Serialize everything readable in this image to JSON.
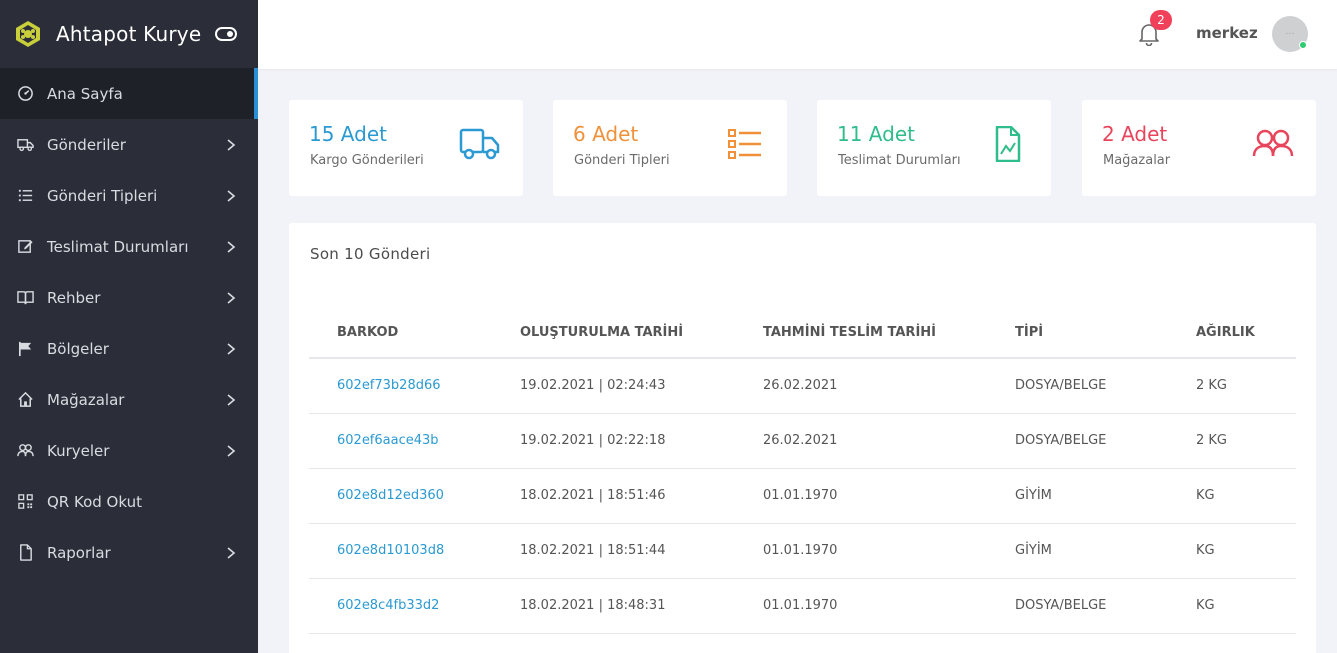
{
  "app": {
    "title": "Ahtapot Kurye"
  },
  "sidebar": {
    "items": [
      {
        "label": "Ana Sayfa",
        "icon": "dashboard-icon",
        "active": true,
        "has_children": false
      },
      {
        "label": "Gönderiler",
        "icon": "truck-icon",
        "active": false,
        "has_children": true
      },
      {
        "label": "Gönderi Tipleri",
        "icon": "list-icon",
        "active": false,
        "has_children": true
      },
      {
        "label": "Teslimat Durumları",
        "icon": "edit-icon",
        "active": false,
        "has_children": true
      },
      {
        "label": "Rehber",
        "icon": "book-icon",
        "active": false,
        "has_children": true
      },
      {
        "label": "Bölgeler",
        "icon": "flag-icon",
        "active": false,
        "has_children": true
      },
      {
        "label": "Mağazalar",
        "icon": "home-icon",
        "active": false,
        "has_children": true
      },
      {
        "label": "Kuryeler",
        "icon": "users-icon",
        "active": false,
        "has_children": true
      },
      {
        "label": "QR Kod Okut",
        "icon": "qr-icon",
        "active": false,
        "has_children": false
      },
      {
        "label": "Raporlar",
        "icon": "file-icon",
        "active": false,
        "has_children": true
      }
    ]
  },
  "topbar": {
    "notification_count": "2",
    "username": "merkez"
  },
  "stats": [
    {
      "value": "15 Adet",
      "label": "Kargo Gönderileri",
      "color": "#2b9ad2",
      "icon": "truck-icon"
    },
    {
      "value": "6 Adet",
      "label": "Gönderi Tipleri",
      "color": "#f0913a",
      "icon": "list-icon"
    },
    {
      "value": "11 Adet",
      "label": "Teslimat Durumları",
      "color": "#2ebd8b",
      "icon": "chart-file-icon"
    },
    {
      "value": "2 Adet",
      "label": "Mağazalar",
      "color": "#e8455c",
      "icon": "users-icon"
    }
  ],
  "recent": {
    "title": "Son 10 Gönderi",
    "columns": [
      "BARKOD",
      "OLUŞTURULMA TARİHİ",
      "TAHMİNİ TESLİM TARİHİ",
      "TİPİ",
      "AĞIRLIK"
    ],
    "rows": [
      [
        "602ef73b28d66",
        "19.02.2021 | 02:24:43",
        "26.02.2021",
        "DOSYA/BELGE",
        "2 KG"
      ],
      [
        "602ef6aace43b",
        "19.02.2021 | 02:22:18",
        "26.02.2021",
        "DOSYA/BELGE",
        "2 KG"
      ],
      [
        "602e8d12ed360",
        "18.02.2021 | 18:51:46",
        "01.01.1970",
        "GİYİM",
        "KG"
      ],
      [
        "602e8d10103d8",
        "18.02.2021 | 18:51:44",
        "01.01.1970",
        "GİYİM",
        "KG"
      ],
      [
        "602e8c4fb33d2",
        "18.02.2021 | 18:48:31",
        "01.01.1970",
        "DOSYA/BELGE",
        "KG"
      ]
    ]
  }
}
